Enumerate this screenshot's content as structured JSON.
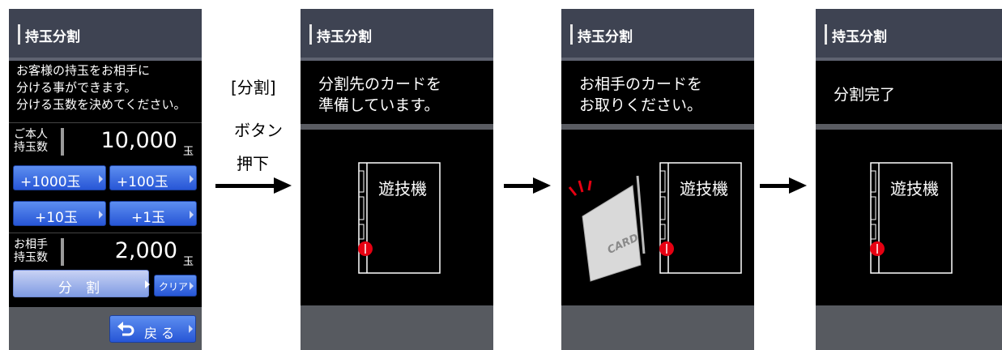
{
  "screen_title": "持玉分割",
  "panel1": {
    "intro": "お客様の持玉をお相手に\n分ける事ができます。\n分ける玉数を決めてください。",
    "own_label": "ご本人\n持玉数",
    "own_value": "10,000",
    "unit": "玉",
    "partner_label": "お相手\n持玉数",
    "partner_value": "2,000",
    "buttons": {
      "plus1000": "+1000玉",
      "plus100": "+100玉",
      "plus10": "+10玉",
      "plus1": "+1玉",
      "split": "分　割",
      "clear": "クリア",
      "back": "戻 る"
    }
  },
  "step_label": [
    "[分割]",
    "ボタン",
    "押下"
  ],
  "panel2": {
    "message": "分割先のカードを\n準備しています。"
  },
  "panel3": {
    "message": "お相手のカードを\nお取りください。"
  },
  "panel4": {
    "message": "分割完了"
  },
  "machine_label": "遊技機",
  "card_label": "CARD",
  "colors": {
    "header": "#3e4352",
    "button_blue": "#2756d6",
    "indicator_red": "#e60012"
  }
}
